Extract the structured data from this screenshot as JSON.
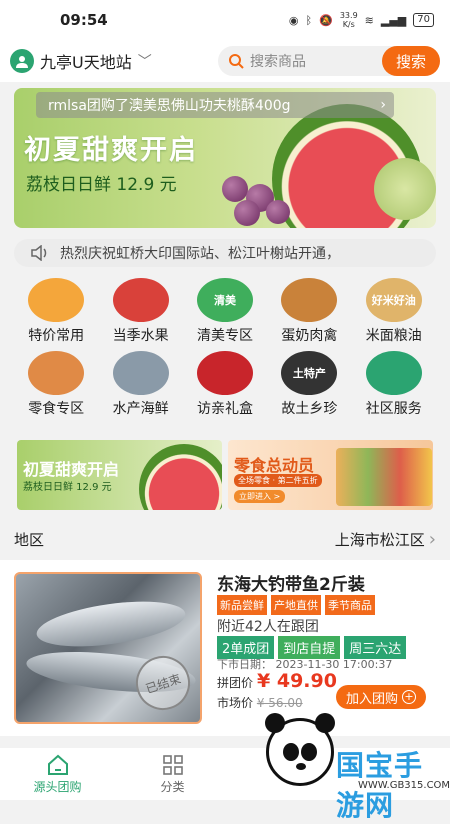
{
  "status": {
    "time": "09:54",
    "net_speed": "33.9",
    "net_unit": "K/s",
    "battery": "70"
  },
  "header": {
    "station": "九亭U天地站",
    "search_placeholder": "搜索商品",
    "search_button": "搜索"
  },
  "banner": {
    "notice": "rmlsa团购了澳美思佛山功夫桃酥400g",
    "title": "初夏甜爽开启",
    "subtitle": "荔枝日日鲜 12.9 元"
  },
  "marquee": "热烈庆祝虹桥大印国际站、松江叶榭站开通，",
  "categories": [
    {
      "label": "特价常用",
      "icon": "discount-icon",
      "color": "#f4a63b"
    },
    {
      "label": "当季水果",
      "icon": "apple-icon",
      "color": "#d9413a"
    },
    {
      "label": "清美专区",
      "icon": "qingmei-logo-icon",
      "color": "#3fae5c",
      "text": "清美"
    },
    {
      "label": "蛋奶肉禽",
      "icon": "chicken-icon",
      "color": "#c9823a"
    },
    {
      "label": "米面粮油",
      "icon": "rice-oil-icon",
      "color": "#e0b46a",
      "text": "好米好油"
    },
    {
      "label": "零食专区",
      "icon": "snack-icon",
      "color": "#e08a46"
    },
    {
      "label": "水产海鲜",
      "icon": "fish-icon",
      "color": "#8a9aa8"
    },
    {
      "label": "访亲礼盒",
      "icon": "gift-box-icon",
      "color": "#c8252b"
    },
    {
      "label": "故土乡珍",
      "icon": "calligraphy-icon",
      "color": "#333333",
      "text": "土特产"
    },
    {
      "label": "社区服务",
      "icon": "heart-hands-icon",
      "color": "#2ba471"
    }
  ],
  "promos": [
    {
      "title": "初夏甜爽开启",
      "sub": "荔枝日日鲜 12.9 元"
    },
    {
      "title": "零食总动员",
      "sub": "全场零食 · 第二件五折",
      "cta": "立即进入 >"
    }
  ],
  "region": {
    "label": "地区",
    "city": "上海市松江区"
  },
  "product": {
    "name": "东海大钓带鱼2斤装",
    "tags": [
      "新品尝鲜",
      "产地直供",
      "季节商品"
    ],
    "people": "附近42人在跟团",
    "group_tags": [
      "2单成团",
      "到店自提",
      "周三六达"
    ],
    "deadline": "下市日期： 2023-11-30 17:00:37",
    "price_label": "拼团价",
    "price": "¥ 49.90",
    "market_label": "市场价",
    "market_price": "¥ 56.00",
    "add_button": "加入团购",
    "stamp": "已结束"
  },
  "tabs": [
    {
      "label": "源头团购",
      "icon": "home-icon",
      "active": true
    },
    {
      "label": "分类",
      "icon": "grid-icon",
      "active": false
    }
  ],
  "watermark": {
    "title": "国宝手游网",
    "url": "WWW.GB315.COM"
  },
  "colors": {
    "brand_green": "#2ba471",
    "accent_orange": "#f46a12",
    "price_red": "#e8381f"
  }
}
